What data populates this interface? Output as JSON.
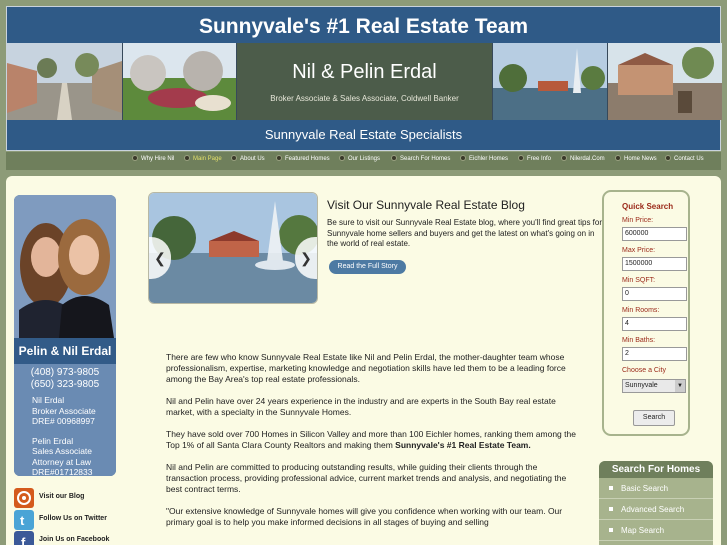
{
  "header": {
    "title": "Sunnyvale's #1 Real Estate Team",
    "names": "Nil & Pelin Erdal",
    "subtitle": "Broker Associate & Sales Associate, Coldwell Banker",
    "tagline": "Sunnyvale Real Estate Specialists"
  },
  "nav": {
    "items": [
      {
        "label": "Why Hire Nil",
        "active": false
      },
      {
        "label": "Main Page",
        "active": true
      },
      {
        "label": "About Us",
        "active": false
      },
      {
        "label": "Featured Homes",
        "active": false
      },
      {
        "label": "Our Listings",
        "active": false
      },
      {
        "label": "Search For Homes",
        "active": false
      },
      {
        "label": "Eichler Homes",
        "active": false
      },
      {
        "label": "Free Info",
        "active": false
      },
      {
        "label": "Nilerdal.Com",
        "active": false
      },
      {
        "label": "Home News",
        "active": false
      },
      {
        "label": "Contact Us",
        "active": false
      }
    ]
  },
  "profile": {
    "name": "Pelin & Nil Erdal",
    "phone1": "(408) 973-9805",
    "phone2": "(650) 323-9805",
    "nil_name": "Nil Erdal",
    "nil_title": "Broker Associate",
    "nil_dre": "DRE# 00968997",
    "pelin_name": "Pelin Erdal",
    "pelin_title": "Sales Associate",
    "pelin_title2": "Attorney at Law",
    "pelin_dre": "DRE#01712833"
  },
  "social": {
    "blog": "Visit our Blog",
    "twitter": "Follow Us on Twitter",
    "facebook": "Join Us on Facebook"
  },
  "blog": {
    "title": "Visit Our Sunnyvale Real Estate Blog",
    "text": "Be sure to visit our Sunnyvale Real Estate blog, where you'll find great tips for Sunnyvale home sellers and buyers and get the latest on what's going on in the world of real estate.",
    "button": "Read the Full Story"
  },
  "content": {
    "p1": "There are few who know Sunnyvale Real Estate like Nil and Pelin Erdal, the mother-daughter team whose professionalism, expertise, marketing knowledge and negotiation skills have led them to be a leading force among the Bay Area's top real estate professionals.",
    "p2": "Nil and Pelin have over 24 years experience in the industry and are experts in the South Bay real estate market, with a specialty in the Sunnyvale Homes.",
    "p3": "They have sold over 700 Homes in Silicon Valley and more than 100 Eichler homes, ranking them among the Top 1% of all Santa Clara County Realtors and making them ",
    "p3_bold": "Sunnyvale's #1 Real Estate Team.",
    "p4": "Nil and Pelin are committed to producing outstanding results, while guiding their clients through the transaction process, providing professional advice, current market trends and analysis, and negotiating the best contract terms.",
    "p5": "\"Our extensive knowledge of Sunnyvale homes will give you confidence when working with our team. Our primary goal is to help you make informed decisions in all stages of buying and selling"
  },
  "quick_search": {
    "title": "Quick Search",
    "min_price_label": "Min Price:",
    "min_price": "600000",
    "max_price_label": "Max Price:",
    "max_price": "1500000",
    "min_sqft_label": "Min SQFT:",
    "min_sqft": "0",
    "min_rooms_label": "Min Rooms:",
    "min_rooms": "4",
    "min_baths_label": "Min Baths:",
    "min_baths": "2",
    "city_label": "Choose a City",
    "city": "Sunnyvale",
    "search_button": "Search"
  },
  "search_homes": {
    "title": "Search For Homes",
    "items": [
      "Basic Search",
      "Advanced Search",
      "Map Search"
    ]
  },
  "colors": {
    "header_blue": "#2f5a87",
    "page_bg": "#8d9b78",
    "content_bg": "#fbfbe4",
    "label_red": "#9b2a1a"
  }
}
